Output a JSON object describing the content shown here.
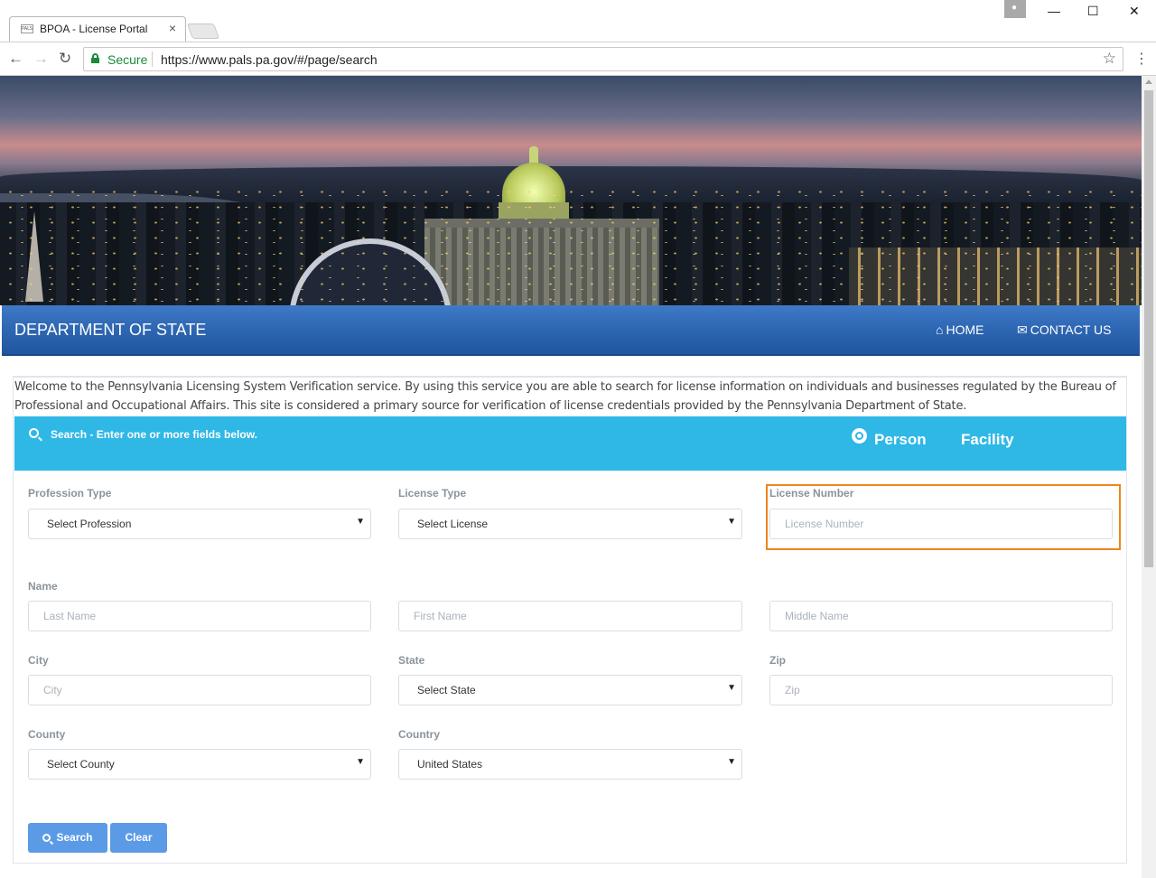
{
  "browser": {
    "tab_title": "BPOA - License Portal",
    "tab_favicon_text": "PALS",
    "tab_close": "×",
    "minimize": "—",
    "maximize": "☐",
    "close": "✕",
    "profile_icon": "person-icon",
    "back": "←",
    "forward": "→",
    "reload": "↻",
    "secure_label": "Secure",
    "url": "https://www.pals.pa.gov/#/page/search",
    "star": "☆",
    "menu": "⋮"
  },
  "header": {
    "department": "DEPARTMENT OF STATE",
    "nav": [
      {
        "label": "HOME",
        "icon": "home-icon"
      },
      {
        "label": "CONTACT US",
        "icon": "envelope-icon"
      }
    ]
  },
  "welcome_text": "Welcome to the Pennsylvania Licensing System Verification service. By using this service you are able to search for license information on individuals and businesses regulated by the Bureau of Professional and Occupational Affairs. This site is considered a primary source for verification of license credentials provided by the Pennsylvania Department of State.",
  "search_bar": {
    "title": "Search - Enter one or more fields below.",
    "options": [
      "Person",
      "Facility"
    ],
    "selected": "Person"
  },
  "form": {
    "profession_type": {
      "label": "Profession Type",
      "value": "Select Profession"
    },
    "license_type": {
      "label": "License Type",
      "value": "Select License"
    },
    "license_number": {
      "label": "License Number",
      "placeholder": "License Number"
    },
    "name_label": "Name",
    "last_name": {
      "placeholder": "Last Name"
    },
    "first_name": {
      "placeholder": "First Name"
    },
    "middle_name": {
      "placeholder": "Middle Name"
    },
    "city": {
      "label": "City",
      "placeholder": "City"
    },
    "state": {
      "label": "State",
      "value": "Select State"
    },
    "zip": {
      "label": "Zip",
      "placeholder": "Zip"
    },
    "county": {
      "label": "County",
      "value": "Select County"
    },
    "country": {
      "label": "Country",
      "value": "United States"
    }
  },
  "buttons": {
    "search": "Search",
    "clear": "Clear"
  },
  "colors": {
    "header_blue": "#2d66b2",
    "search_bar": "#2fb8e6",
    "button": "#5b9be6",
    "highlight": "#f0851b"
  }
}
